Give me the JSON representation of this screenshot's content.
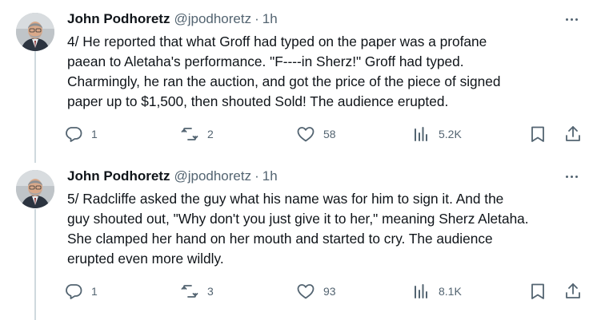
{
  "tweets": [
    {
      "author": {
        "name": "John Podhoretz",
        "handle": "@jpodhoretz",
        "separator": "·",
        "time": "1h"
      },
      "text": "4/ He reported that what Groff had typed on the paper was a profane\npaean to Aletaha's performance. \"F----in Sherz!\" Groff had typed.\nCharmingly, he ran the auction, and got the price of the piece of signed\npaper up to $1,500, then shouted Sold! The audience erupted.",
      "stats": {
        "replies": "1",
        "reposts": "2",
        "likes": "58",
        "views": "5.2K"
      }
    },
    {
      "author": {
        "name": "John Podhoretz",
        "handle": "@jpodhoretz",
        "separator": "·",
        "time": "1h"
      },
      "text": "5/ Radcliffe asked the guy what his name was for him to sign it. And the\nguy shouted out, \"Why don't you just give it to her,\" meaning Sherz Aletaha.\nShe clamped her hand on her mouth and started to cry. The audience\nerupted even more wildly.",
      "stats": {
        "replies": "1",
        "reposts": "3",
        "likes": "93",
        "views": "8.1K"
      }
    }
  ],
  "icons": {
    "reply": "speech-bubble-icon",
    "repost": "repost-arrows-icon",
    "like": "heart-icon",
    "views": "bar-chart-icon",
    "bookmark": "bookmark-icon",
    "share": "share-upload-icon",
    "more": "ellipsis-icon"
  },
  "colors": {
    "text": "#0f1419",
    "secondary": "#536471",
    "thread_line": "#cfd9de"
  }
}
